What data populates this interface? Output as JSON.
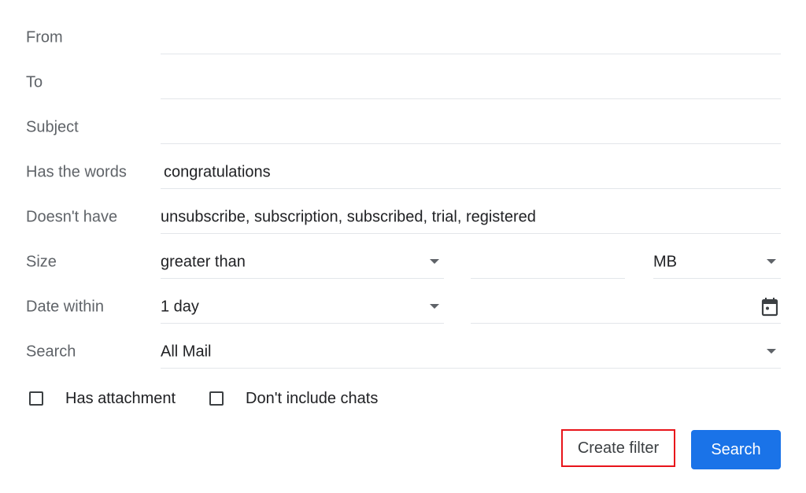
{
  "form": {
    "from": {
      "label": "From",
      "value": ""
    },
    "to": {
      "label": "To",
      "value": ""
    },
    "subject": {
      "label": "Subject",
      "value": ""
    },
    "has_words": {
      "label": "Has the words",
      "value": "congratulations"
    },
    "doesnt_have": {
      "label": "Doesn't have",
      "value": "unsubscribe, subscription, subscribed, trial, registered"
    },
    "size": {
      "label": "Size",
      "operator": "greater than",
      "value": "",
      "unit": "MB"
    },
    "date_within": {
      "label": "Date within",
      "range": "1 day",
      "date": ""
    },
    "search": {
      "label": "Search",
      "value": "All Mail"
    },
    "has_attachment": {
      "label": "Has attachment",
      "checked": false
    },
    "dont_include_chats": {
      "label": "Don't include chats",
      "checked": false
    }
  },
  "buttons": {
    "create_filter": "Create filter",
    "search": "Search"
  },
  "colors": {
    "primary": "#1a73e8",
    "highlight": "#e8141a"
  }
}
